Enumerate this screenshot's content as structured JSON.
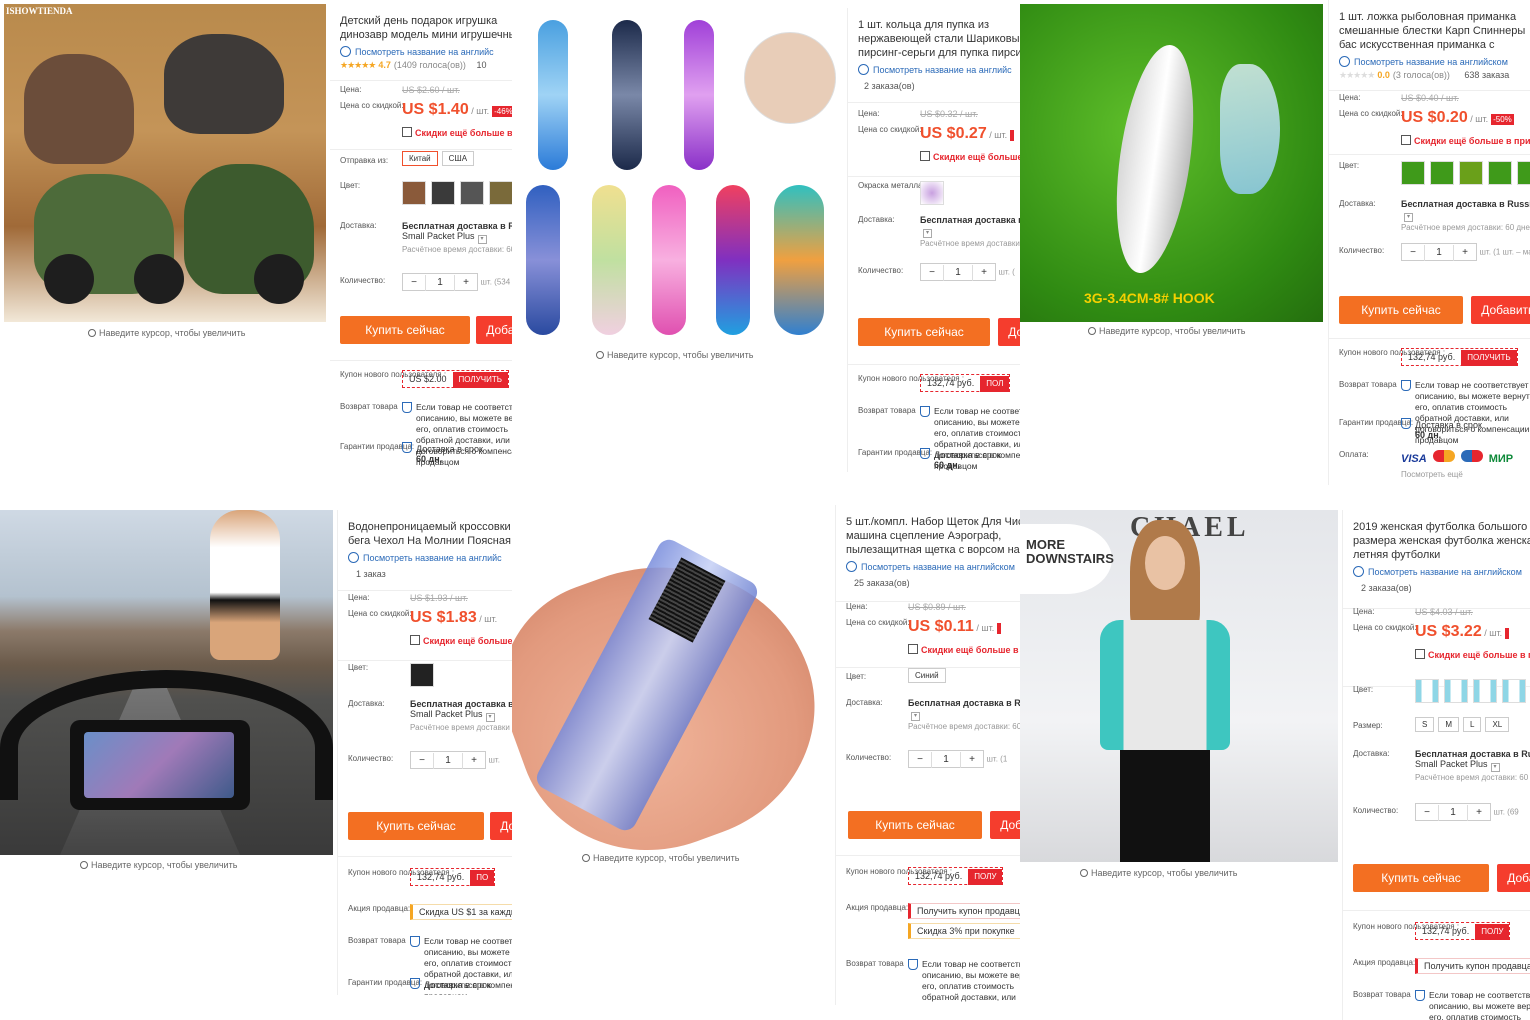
{
  "common": {
    "translate_link": "Посмотреть название на английском",
    "translate_link_cut": "Посмотреть название на английс",
    "zoom_hint": "Наведите курсор, чтобы увеличить",
    "price_label": "Цена:",
    "discount_price_label": "Цена со скидкой:",
    "per_unit": "/ шт.",
    "promo_app": "Скидки ещё больше в приложении",
    "ship_from_label": "Отправка из:",
    "color_label": "Цвет:",
    "size_label": "Размер:",
    "delivery_label": "Доставка:",
    "quantity_label": "Количество:",
    "metal_color_label": "Окраска металла:",
    "free_delivery": "Бесплатная доставка в Russian Federation",
    "free_delivery_cut": "Бесплатная доставка в Ru",
    "small_packet": "Small Packet Plus",
    "est_time": "Расчётное время доставки: 60 дней",
    "buy_now": "Купить сейчас",
    "add_to_cart": "Добавить в корзину",
    "new_user_coupon_label": "Купон нового пользователя :",
    "get_coupon": "ПОЛУЧИТЬ",
    "promo_label": "Акция продавца:",
    "return_label": "Возврат товара",
    "return_text": "Если товар не соответствует описанию, вы можете вернуть его, оплатив стоимость обратной доставки, или договориться о компенсации с продавцом",
    "guarantee_label": "Гарантии продавца:",
    "guarantee_text": "Доставка в срок",
    "guarantee_days": "60 дн.",
    "payment_label": "Оплата:",
    "see_more": "Посмотреть ещё",
    "accent_orange": "#f36f22",
    "accent_red": "#e6262e",
    "price_color": "#f0502d",
    "link_blue": "#2b6ab8"
  },
  "products": [
    {
      "brand_watermark": "ISHOWTIENDA",
      "title": "Детский день подарок игрушка динозавр модель мини игрушечный автомобиль задняя часть автомобиля",
      "rating": "★★★★★",
      "rating_value": "4.7",
      "votes": "(1409 голоса(ов))",
      "orders": "10",
      "old_price": "US $2.60 / шт.",
      "price": "US $1.40",
      "discount": "-46%",
      "ship_from": [
        "Китай",
        "США"
      ],
      "qty": "1",
      "qty_avail": "шт. (534",
      "coupon": "US $2.00"
    },
    {
      "title": "1 шт. кольца для пупка из нержавеющей стали Шариковые пирсинг-серьги для пупка пирсинга ombligo",
      "orders": "2 заказа(ов)",
      "old_price": "US $0.32 / шт.",
      "price": "US $0.27",
      "qty": "1",
      "qty_avail": "шт. (",
      "coupon": "132,74 руб.",
      "get_coupon": "ПОЛ"
    },
    {
      "image_caption": "3G-3.4CM-8# HOOK",
      "title": "1 шт. ложка рыболовная приманка смешанные блестки Карп Спиннеры бас искусственная приманка с крючком",
      "rating": "★★★★★",
      "rating_value": "0.0",
      "votes": "(3 голоса(ов))",
      "orders": "638 заказа",
      "old_price": "US $0.40 / шт.",
      "price": "US $0.20",
      "discount": "-50%",
      "qty": "1",
      "qty_avail": "шт. (1 шт. – ма",
      "coupon": "132,74 руб.",
      "payments": [
        "VISA",
        "MasterCard",
        "Maestro",
        "МИР"
      ]
    },
    {
      "title": "Водонепроницаемый кроссовки для бега Чехол На Молнии Поясная сумка",
      "orders": "1 заказ",
      "old_price": "US $1.93 / шт.",
      "price": "US $1.83",
      "qty": "1",
      "qty_avail": "шт.",
      "coupon": "132,74 руб.",
      "get_coupon": "ПО",
      "promo": "Скидка US $1 за каждые",
      "est_time": "Расчётное время доставки"
    },
    {
      "title": "5 шт./компл. Набор Щеток Для Чистки машина сцепление Аэрограф, пылезащитная щетка с ворсом на кончиках набор инструментов",
      "orders": "25 заказа(ов)",
      "old_price": "US $0.89 / шт.",
      "price": "US $0.11",
      "color_value": "Синий",
      "qty": "1",
      "qty_avail": "шт. (1",
      "coupon": "132,74 руб.",
      "get_coupon": "ПОЛУ",
      "promo1": "Получить купон продавца",
      "promo2": "Скидка 3% при покупке"
    },
    {
      "image_text": "MORE DOWNSTAIRS",
      "image_text2": "CHAEL",
      "title": "2019 женская футболка большого размера женская футболка женская летняя футболки",
      "orders": "2 заказа(ов)",
      "old_price": "US $4.03 / шт.",
      "price": "US $3.22",
      "sizes": [
        "S",
        "M",
        "L",
        "XL"
      ],
      "qty": "1",
      "qty_avail": "шт. (69",
      "coupon": "132,74 руб.",
      "get_coupon": "ПОЛУ",
      "promo1": "Получить купон продавца"
    }
  ]
}
